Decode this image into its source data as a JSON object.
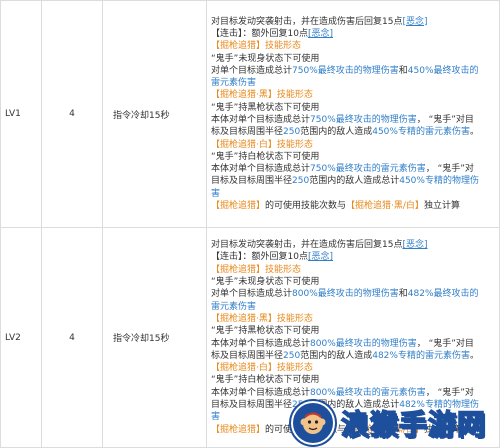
{
  "rows": [
    {
      "level": "LV1",
      "count": "4",
      "cooldown": "指令冷却15秒",
      "lines": [
        [
          [
            "对目标发动突袭射击，并在造成伤害后回复",
            ""
          ],
          [
            "15点",
            ""
          ],
          [
            "[恶念]",
            "bu"
          ]
        ],
        [
          [
            "【连击】：额外回复",
            ""
          ],
          [
            "10点",
            ""
          ],
          [
            "[恶念]",
            "bu"
          ]
        ],
        [
          [
            "【掘枪追猎】技能形态",
            "o"
          ]
        ],
        [
          [
            "“鬼手”未现身状态下可使用",
            ""
          ]
        ],
        [
          [
            "对单个目标造成总计",
            ""
          ],
          [
            "750%最终攻击的物理伤害",
            "b"
          ],
          [
            "和",
            ""
          ],
          [
            "450%最终攻击的",
            "b"
          ]
        ],
        [
          [
            "雷元素伤害",
            "b"
          ]
        ],
        [
          [
            "【掘枪追猎·黑】技能形态",
            "o"
          ]
        ],
        [
          [
            "“鬼手”持黑枪状态下可使用",
            ""
          ]
        ],
        [
          [
            "本体对单个目标造成总计",
            ""
          ],
          [
            "750%最终攻击的物理伤害",
            "b"
          ],
          [
            "，  “鬼手”对目",
            ""
          ]
        ],
        [
          [
            "标及目标周围半径",
            ""
          ],
          [
            "250",
            "b"
          ],
          [
            "范围内的敌人造成",
            ""
          ],
          [
            "450%专精的雷元素伤害",
            "b"
          ],
          [
            "。",
            ""
          ]
        ],
        [
          [
            "【掘枪追猎·白】技能形态",
            "o"
          ]
        ],
        [
          [
            "“鬼手”持白枪状态下可使用",
            ""
          ]
        ],
        [
          [
            "本体对单个目标造成总计",
            ""
          ],
          [
            "750%最终攻击的雷元素伤害",
            "b"
          ],
          [
            "，  “鬼手”对",
            ""
          ]
        ],
        [
          [
            "目标及目标周围半径",
            ""
          ],
          [
            "250",
            "b"
          ],
          [
            "范围内的敌人造成总计",
            ""
          ],
          [
            "450%专精的物理伤",
            "b"
          ]
        ],
        [
          [
            "害",
            "b"
          ]
        ],
        [
          [
            "【掘枪追猎】",
            "o"
          ],
          [
            "的可使用技能次数与",
            ""
          ],
          [
            "【掘枪追猎·黑/白】",
            "o"
          ],
          [
            "独立计算",
            ""
          ]
        ]
      ]
    },
    {
      "level": "LV2",
      "count": "4",
      "cooldown": "指令冷却15秒",
      "lines": [
        [
          [
            "对目标发动突袭射击，并在造成伤害后回复",
            ""
          ],
          [
            "15点",
            ""
          ],
          [
            "[恶念]",
            "bu"
          ]
        ],
        [
          [
            "【连击】：额外回复",
            ""
          ],
          [
            "10点",
            ""
          ],
          [
            "[恶念]",
            "bu"
          ]
        ],
        [
          [
            "【掘枪追猎】技能形态",
            "o"
          ]
        ],
        [
          [
            "“鬼手”未现身状态下可使用",
            ""
          ]
        ],
        [
          [
            "对单个目标造成总计",
            ""
          ],
          [
            "800%最终攻击的物理伤害",
            "b"
          ],
          [
            "和",
            ""
          ],
          [
            "482%最终攻击的",
            "b"
          ]
        ],
        [
          [
            "雷元素伤害",
            "b"
          ]
        ],
        [
          [
            "【掘枪追猎·黑】技能形态",
            "o"
          ]
        ],
        [
          [
            "“鬼手”持黑枪状态下可使用",
            ""
          ]
        ],
        [
          [
            "本体对单个目标造成总计",
            ""
          ],
          [
            "800%最终攻击的物理伤害",
            "b"
          ],
          [
            "，  “鬼手”对目",
            ""
          ]
        ],
        [
          [
            "标及目标周围半径",
            ""
          ],
          [
            "250",
            "b"
          ],
          [
            "范围内的敌人造成",
            ""
          ],
          [
            "482%专精的雷元素伤害",
            "b"
          ],
          [
            "。",
            ""
          ]
        ],
        [
          [
            "【掘枪追猎·白】技能形态",
            "o"
          ]
        ],
        [
          [
            "“鬼手”持白枪状态下可使用",
            ""
          ]
        ],
        [
          [
            "本体对单个目标造成总计",
            ""
          ],
          [
            "800%最终攻击的雷元素伤害",
            "b"
          ],
          [
            "，  “鬼手”对",
            ""
          ]
        ],
        [
          [
            "目标及目标周围半径",
            ""
          ],
          [
            "250",
            "b"
          ],
          [
            "范围内的敌人造成总计",
            ""
          ],
          [
            "482%专精的物理伤",
            "b"
          ]
        ],
        [
          [
            "害",
            "b"
          ]
        ],
        [
          [
            "【掘枪追猎】",
            "o"
          ],
          [
            "的可使用技能次数与",
            ""
          ],
          [
            "【掘枪追猎·黑/白】",
            "o"
          ],
          [
            "独立计算",
            ""
          ]
        ]
      ]
    }
  ],
  "watermark": {
    "text": "浪猴手游网",
    "icon": "monkey-logo-icon",
    "color": "#1d4f9c"
  }
}
